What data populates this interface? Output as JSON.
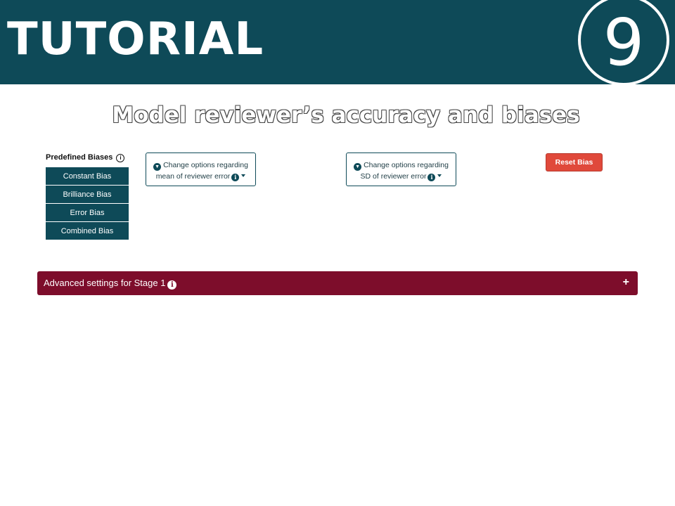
{
  "banner": {
    "title": "TUTORIAL",
    "step_number": "9",
    "background_color": "#0e4a58"
  },
  "subtitle": "Model reviewer’s accuracy and biases",
  "predefined_biases": {
    "label": "Predefined Biases",
    "info_glyph": "i",
    "items": [
      {
        "label": "Constant Bias"
      },
      {
        "label": "Brilliance Bias"
      },
      {
        "label": "Error Bias"
      },
      {
        "label": "Combined Bias"
      }
    ]
  },
  "options": {
    "mean_button": {
      "line1": "Change options regarding",
      "line2": "mean of reviewer error"
    },
    "sd_button": {
      "line1": "Change options regarding",
      "line2": "SD of reviewer error"
    }
  },
  "reset_button": {
    "label": "Reset Bias",
    "color": "#e0493b"
  },
  "advanced": {
    "label": "Advanced settings for Stage 1",
    "color": "#7d0d2b",
    "expand_icon": "plus-icon"
  }
}
